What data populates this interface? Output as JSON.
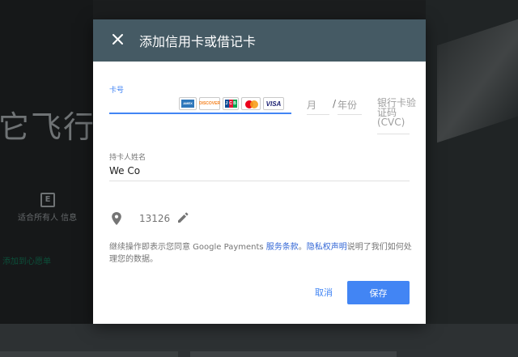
{
  "background": {
    "title_fragment": "它飞行模",
    "rating_text": "适合所有人 信息",
    "wishlist_text": "添加到心愿单"
  },
  "dialog": {
    "title": "添加信用卡或借记卡",
    "card_number": {
      "label": "卡号",
      "value": "",
      "card_brands": [
        "AMEX",
        "DISCOVER",
        "JCB",
        "MasterCard",
        "VISA"
      ]
    },
    "expiry": {
      "month_placeholder": "月",
      "separator": "/",
      "year_placeholder": "年份"
    },
    "cvc_placeholder": "银行卡验证码(CVC)",
    "cardholder": {
      "label": "持卡人姓名",
      "value": "We Co"
    },
    "billing": {
      "zip": "13126",
      "location_icon": "location-pin-icon",
      "edit_icon": "pencil-icon"
    },
    "terms": {
      "prefix": "继续操作即表示您同意 Google Payments ",
      "link1": "服务条款",
      "middle": "。",
      "link2": "隐私权声明",
      "suffix": "说明了我们如何处理您的数据。"
    },
    "buttons": {
      "cancel": "取消",
      "save": "保存"
    }
  },
  "colors": {
    "header": "#455a64",
    "accent": "#4285f4",
    "link": "#3367d6"
  }
}
